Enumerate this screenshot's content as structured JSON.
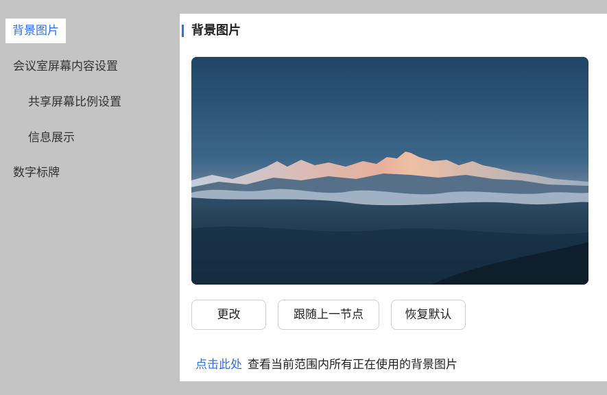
{
  "colors": {
    "accent": "#2f6ff0",
    "page_bg": "#c4c4c4",
    "panel_bg": "#ffffff"
  },
  "sidebar": {
    "items": [
      {
        "label": "背景图片",
        "active": true
      },
      {
        "label": "会议室屏幕内容设置",
        "active": false
      },
      {
        "label": "共享屏幕比例设置",
        "active": false
      },
      {
        "label": "信息展示",
        "active": false
      },
      {
        "label": "数字标牌",
        "active": false
      }
    ]
  },
  "main": {
    "title": "背景图片",
    "preview_image": "mountain-sunset-landscape",
    "buttons": {
      "change": "更改",
      "follow_parent": "跟随上一节点",
      "restore_default": "恢复默认"
    },
    "footer": {
      "link": "点击此处",
      "text": "查看当前范围内所有正在使用的背景图片"
    }
  }
}
